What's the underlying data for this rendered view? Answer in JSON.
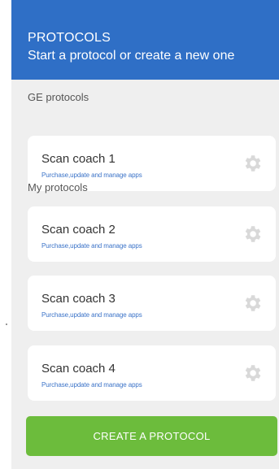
{
  "header": {
    "title": "PROTOCOLS",
    "subtitle": "Start a protocol or create a new one"
  },
  "sections": {
    "ge_label": "GE protocols",
    "my_label": "My protocols"
  },
  "protocols": [
    {
      "name": "Scan coach 1",
      "sub": "Purchase,update and manage apps",
      "icon": "gear-icon"
    },
    {
      "name": "Scan coach 2",
      "sub": "Purchase,update and manage apps",
      "icon": "gear-icon"
    },
    {
      "name": "Scan coach 3",
      "sub": "Purchase,update and manage apps",
      "icon": "gear-icon"
    },
    {
      "name": "Scan coach 4",
      "sub": "Purchase,update and manage apps",
      "icon": "gear-icon"
    }
  ],
  "cta": {
    "label": "CREATE A  PROTOCOL"
  },
  "colors": {
    "header_bg": "#2f6fc6",
    "panel_bg": "#efefef",
    "cta_bg": "#6cbc3c",
    "link_blue": "#3b73c8"
  }
}
